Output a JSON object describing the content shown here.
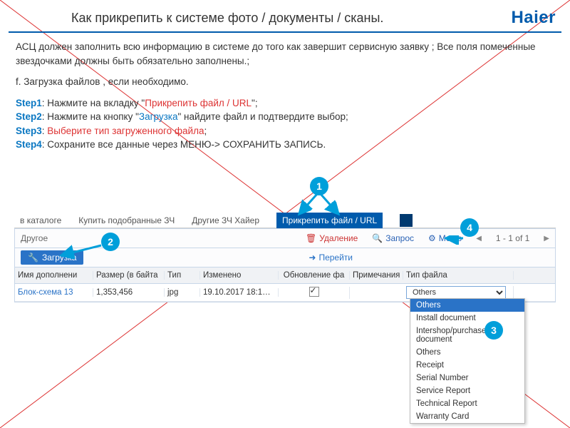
{
  "header": {
    "title": "Как прикрепить к системе фото / документы / сканы.",
    "brand": "Haier"
  },
  "intro": {
    "p1": "АСЦ должен заполнить всю информацию в системе до того как завершит сервисную заявку ; Все поля помеченные звездочками должны быть обязательно заполнены.;",
    "p2": "f. Загрузка файлов , если необходимо."
  },
  "steps": [
    {
      "label": "Step1",
      "pre": ": Нажмите на вкладку \"",
      "hl": "Прикрепить файл / URL",
      "post": "\";"
    },
    {
      "label": "Step2",
      "pre": ": Нажмите на кнопку \"",
      "hl": "Загрузка",
      "post": "\" найдите файл и подтвердите выбор;"
    },
    {
      "label": "Step3",
      "pre": ": ",
      "hl": "Выберите тип загруженного файла",
      "post": ";"
    },
    {
      "label": "Step4",
      "pre": ": Сохраните все данные через  МЕНЮ-> СОХРАНИТЬ ЗАПИСЬ.",
      "hl": "",
      "post": ""
    }
  ],
  "callouts": [
    "1",
    "2",
    "3",
    "4"
  ],
  "app": {
    "tabs": [
      "в каталоге",
      "Купить подобранные ЗЧ",
      "Другие ЗЧ Хайер",
      "Прикрепить файл / URL"
    ],
    "panel": {
      "label": "Другое"
    },
    "toolbar": {
      "delete": "Удаление",
      "query": "Запрос",
      "menu": "Меню",
      "paging": "1 - 1 of 1",
      "upload": "Загрузка",
      "goto": "Перейти"
    },
    "grid": {
      "headers": [
        "Имя дополнени",
        "Размер (в байта",
        "Тип",
        "Изменено",
        "Обновление фа",
        "Примечания",
        "Тип файла"
      ],
      "rows": [
        {
          "name": "Блок-схема 13",
          "size": "1,353,456",
          "type": "jpg",
          "modified": "19.10.2017 18:1…",
          "update": true,
          "note": "",
          "fileType": "Others"
        }
      ]
    },
    "fileTypeOptions": [
      "Others",
      "Install document",
      "Intershop/purchase document",
      "Others",
      "Receipt",
      "Serial Number",
      "Service Report",
      "Technical Report",
      "Warranty Card"
    ]
  }
}
